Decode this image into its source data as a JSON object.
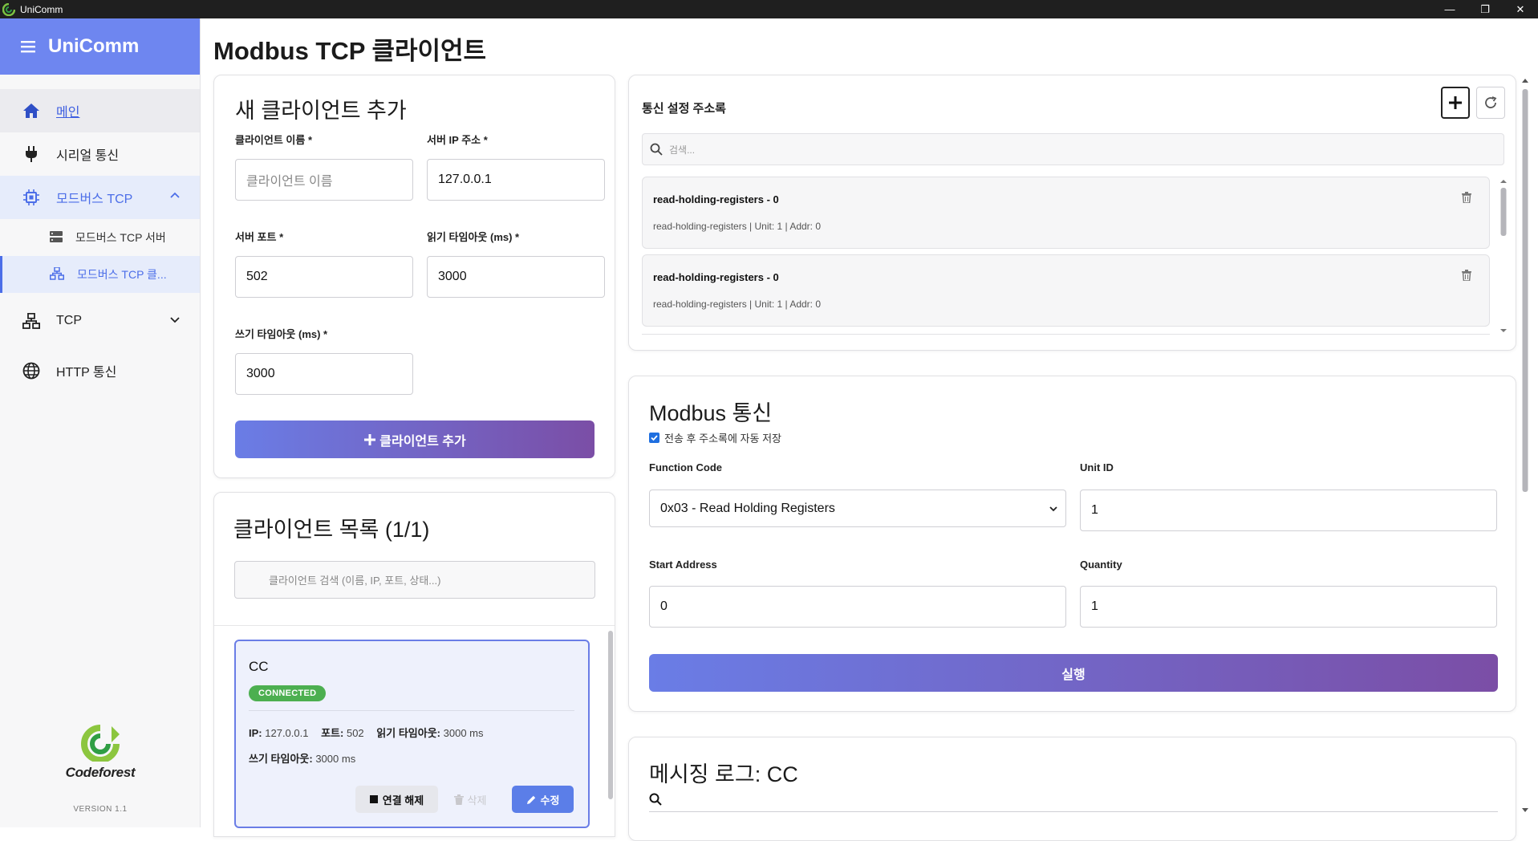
{
  "window": {
    "title": "UniComm",
    "minimize": "—",
    "restore": "❐",
    "close": "✕"
  },
  "sidebar": {
    "brand": "UniComm",
    "items": [
      {
        "label": "메인",
        "icon": "home-icon"
      },
      {
        "label": "시리얼 통신",
        "icon": "plug-icon"
      },
      {
        "label": "모드버스 TCP",
        "icon": "chip-icon"
      },
      {
        "label": "TCP",
        "icon": "network-icon"
      },
      {
        "label": "HTTP 통신",
        "icon": "globe-icon"
      }
    ],
    "sub_items": [
      {
        "label": "모드버스 TCP 서버",
        "icon": "server-icon"
      },
      {
        "label": "모드버스 TCP 클...",
        "icon": "network-icon"
      }
    ],
    "logo_name": "Codeforest",
    "version": "VERSION 1.1"
  },
  "page": {
    "title": "Modbus TCP 클라이언트"
  },
  "add_client": {
    "heading": "새 클라이언트 추가",
    "name_label": "클라이언트 이름 *",
    "name_placeholder": "클라이언트 이름",
    "ip_label": "서버 IP 주소 *",
    "ip_value": "127.0.0.1",
    "port_label": "서버 포트 *",
    "port_value": "502",
    "read_timeout_label": "읽기 타임아웃 (ms) *",
    "read_timeout_value": "3000",
    "write_timeout_label": "쓰기 타임아웃 (ms) *",
    "write_timeout_value": "3000",
    "add_button": "클라이언트 추가"
  },
  "client_list": {
    "heading": "클라이언트 목록 (1/1)",
    "search_placeholder": "클라이언트 검색 (이름, IP, 포트, 상태...)",
    "clients": [
      {
        "name": "CC",
        "status": "CONNECTED",
        "ip_label": "IP:",
        "ip": "127.0.0.1",
        "port_label": "포트:",
        "port": "502",
        "read_timeout_label": "읽기 타임아웃:",
        "read_timeout": "3000 ms",
        "write_timeout_label": "쓰기 타임아웃:",
        "write_timeout": "3000 ms",
        "disconnect_button": "연결 해제",
        "delete_button": "삭제",
        "edit_button": "수정"
      }
    ]
  },
  "address_book": {
    "heading": "통신 설정 주소록",
    "search_placeholder": "검색...",
    "items": [
      {
        "title": "read-holding-registers - 0",
        "detail": "read-holding-registers | Unit: 1 | Addr: 0"
      },
      {
        "title": "read-holding-registers - 0",
        "detail": "read-holding-registers | Unit: 1 | Addr: 0"
      }
    ]
  },
  "modbus": {
    "heading": "Modbus 통신",
    "autosave_label": "전송 후 주소록에 자동 저장",
    "autosave_checked": true,
    "function_code_label": "Function Code",
    "function_code_value": "0x03 - Read Holding Registers",
    "unit_id_label": "Unit ID",
    "unit_id_value": "1",
    "start_address_label": "Start Address",
    "start_address_value": "0",
    "quantity_label": "Quantity",
    "quantity_value": "1",
    "execute_button": "실행"
  },
  "log": {
    "heading": "메시징 로그: CC"
  },
  "colors": {
    "accent": "#6e86f0",
    "gradient_start": "#6a7de6",
    "gradient_end": "#7b4ea6",
    "connected": "#4caf50"
  }
}
